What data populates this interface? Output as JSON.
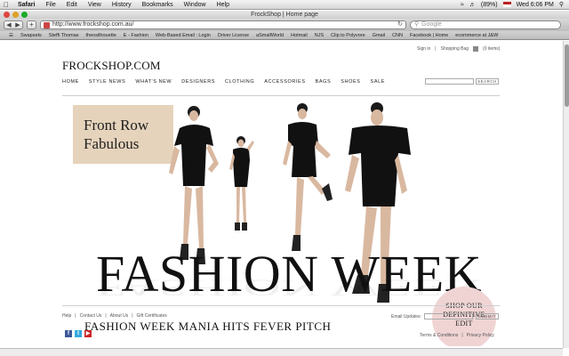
{
  "menubar": {
    "app": "Safari",
    "items": [
      "File",
      "Edit",
      "View",
      "History",
      "Bookmarks",
      "Window",
      "Help"
    ],
    "battery": "(89%)",
    "clock": "Wed 6:06 PM"
  },
  "window": {
    "title": "FrockShop | Home page",
    "url": "http://www.frockshop.com.au/",
    "search_placeholder": "Google"
  },
  "bookmarks": [
    "Swapsets",
    "Steffi Thomas",
    "theosilhouette",
    "E - Fashion",
    "Web-Based Email : Login",
    "Driver License",
    "aSmallWorld",
    "Hotmail",
    "NJS",
    "Clip to Polyvore",
    "Gmail",
    "CNN",
    "Facebook | Home",
    "ecommerce at J&W"
  ],
  "header": {
    "sign_in": "Sign in",
    "shopping_bag": "Shopping Bag",
    "bag_count": "(0 items)",
    "logo": "FROCKSHOP.COM"
  },
  "nav": {
    "items": [
      "HOME",
      "STYLE NEWS",
      "WHAT'S NEW",
      "DESIGNERS",
      "CLOTHING",
      "ACCESSORIES",
      "BAGS",
      "SHOES",
      "SALE"
    ],
    "search_button": "SEARCH"
  },
  "hero": {
    "badge_line1": "Front Row",
    "badge_line2": "Fabulous",
    "headline": "FASHION WEEK",
    "subhead": "FASHION WEEK MANIA HITS FEVER PITCH",
    "cta_line1": "SHOP OUR",
    "cta_line2": "DEFINITIVE",
    "cta_line3": "EDIT"
  },
  "footer": {
    "links": [
      "Help",
      "Contact Us",
      "About Us",
      "Gift Certificates"
    ],
    "email_label": "Email Updates:",
    "submit": "SUBMIT",
    "terms": "Terms & Conditions",
    "privacy": "Privacy Policy"
  },
  "colors": {
    "badge": "#e5d3bb",
    "cta_circle": "#f0d4d4",
    "facebook": "#3b5998",
    "twitter": "#33aadd",
    "youtube": "#cc2222"
  }
}
